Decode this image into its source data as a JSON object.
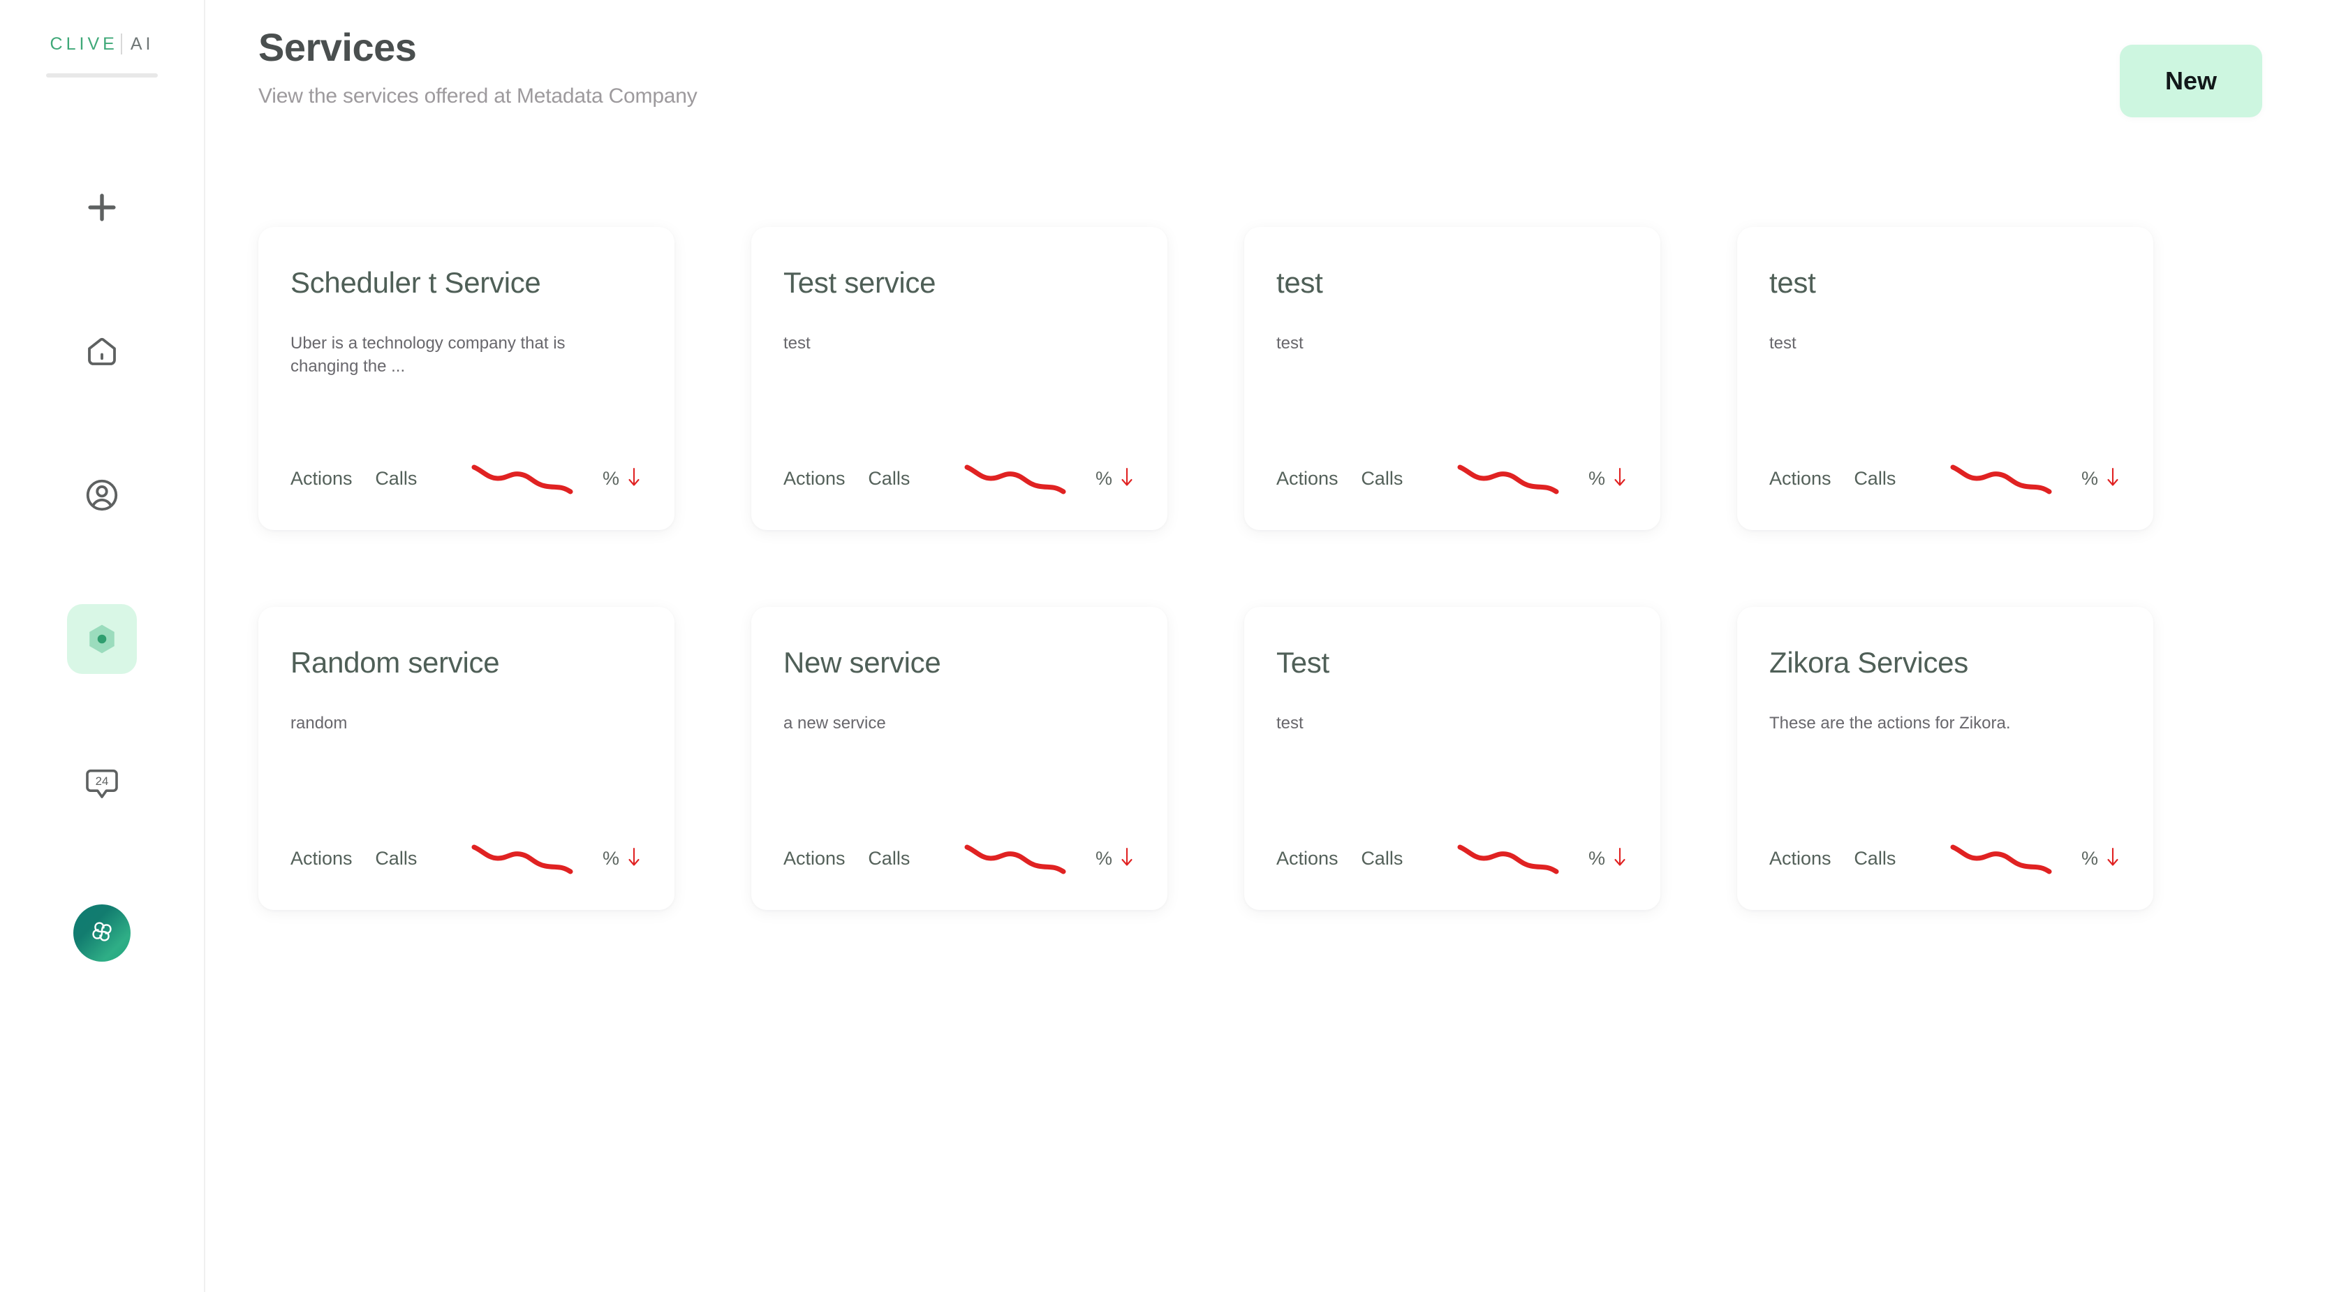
{
  "brand": {
    "name": "CLIVE",
    "suffix": "AI"
  },
  "colors": {
    "accent_green": "#3fa878",
    "mint_bg": "#cdf6e0",
    "active_nav_bg": "#d9f7e6",
    "title_gray": "#4a4f4f",
    "subtitle_gray": "#9d9a9d",
    "card_title": "#4f5f57",
    "trend_red": "#e02222"
  },
  "sidebar": {
    "items": [
      {
        "icon": "plus-icon",
        "name": "add",
        "active": false
      },
      {
        "icon": "home-icon",
        "name": "home",
        "active": false
      },
      {
        "icon": "user-circle-icon",
        "name": "profile",
        "active": false
      },
      {
        "icon": "hexagon-services-icon",
        "name": "services",
        "active": true
      },
      {
        "icon": "support-24-icon",
        "name": "support",
        "active": false
      }
    ],
    "avatar": {
      "icon": "pinwheel-logo-icon",
      "name": "account-avatar"
    }
  },
  "header": {
    "title": "Services",
    "subtitle": "View the services offered at Metadata Company",
    "new_button_label": "New"
  },
  "cards_common": {
    "actions_label": "Actions",
    "calls_label": "Calls",
    "percent_label": "%",
    "trend_direction": "down"
  },
  "services": [
    {
      "title": "Scheduler t Service",
      "description": "Uber is a technology company that is changing the ..."
    },
    {
      "title": "Test service",
      "description": "test"
    },
    {
      "title": "test",
      "description": "test"
    },
    {
      "title": "test",
      "description": "test"
    },
    {
      "title": "Random service",
      "description": "random"
    },
    {
      "title": "New service",
      "description": "a new service"
    },
    {
      "title": "Test",
      "description": "test"
    },
    {
      "title": "Zikora Services",
      "description": "These are the actions for Zikora."
    }
  ]
}
